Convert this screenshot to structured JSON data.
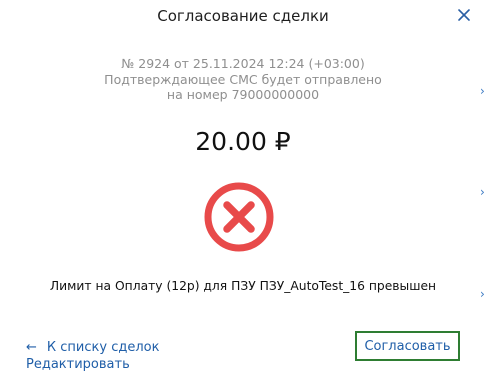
{
  "dialog": {
    "title": "Согласование сделки",
    "deal_info": "№ 2924 от 25.11.2024 12:24 (+03:00)",
    "sms_notice": "Подтверждающее СМС будет отправлено",
    "sms_phone": "на номер 79000000000",
    "amount": "20.00 ₽",
    "status": "error",
    "error_message": "Лимит на Оплату (12р) для ПЗУ ПЗУ_AutoTest_16 превышен"
  },
  "footer": {
    "back_link": "К списку сделок",
    "edit_link": "Редактировать",
    "approve_button": "Согласовать"
  },
  "icons": {
    "close": "close-icon",
    "status": "error-circle-icon",
    "back_arrow": "arrow-left-icon",
    "edge": "chevron-right-icon"
  },
  "colors": {
    "error_red": "#e84a4a",
    "link_blue": "#1f5ea8",
    "approve_border": "#2e7d32"
  }
}
